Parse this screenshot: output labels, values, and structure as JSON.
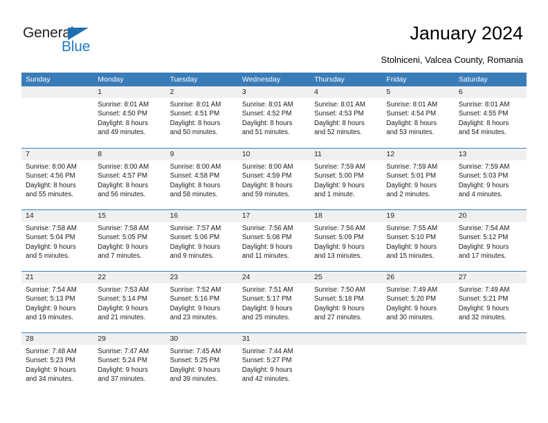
{
  "brand": {
    "name_part1": "General",
    "name_part2": "Blue",
    "triangle_color": "#1f6fb5",
    "blue_color": "#1f7ac4"
  },
  "header": {
    "title": "January 2024",
    "subtitle": "Stolniceni, Valcea County, Romania"
  },
  "colors": {
    "header_band": "#3a7cb8",
    "day_band": "#f0f0f0",
    "text": "#000000"
  },
  "weekdays": [
    "Sunday",
    "Monday",
    "Tuesday",
    "Wednesday",
    "Thursday",
    "Friday",
    "Saturday"
  ],
  "weeks": [
    [
      {
        "day": "",
        "sunrise": "",
        "sunset": "",
        "daylight_line1": "",
        "daylight_line2": "",
        "empty": true
      },
      {
        "day": "1",
        "sunrise": "Sunrise: 8:01 AM",
        "sunset": "Sunset: 4:50 PM",
        "daylight_line1": "Daylight: 8 hours",
        "daylight_line2": "and 49 minutes."
      },
      {
        "day": "2",
        "sunrise": "Sunrise: 8:01 AM",
        "sunset": "Sunset: 4:51 PM",
        "daylight_line1": "Daylight: 8 hours",
        "daylight_line2": "and 50 minutes."
      },
      {
        "day": "3",
        "sunrise": "Sunrise: 8:01 AM",
        "sunset": "Sunset: 4:52 PM",
        "daylight_line1": "Daylight: 8 hours",
        "daylight_line2": "and 51 minutes."
      },
      {
        "day": "4",
        "sunrise": "Sunrise: 8:01 AM",
        "sunset": "Sunset: 4:53 PM",
        "daylight_line1": "Daylight: 8 hours",
        "daylight_line2": "and 52 minutes."
      },
      {
        "day": "5",
        "sunrise": "Sunrise: 8:01 AM",
        "sunset": "Sunset: 4:54 PM",
        "daylight_line1": "Daylight: 8 hours",
        "daylight_line2": "and 53 minutes."
      },
      {
        "day": "6",
        "sunrise": "Sunrise: 8:01 AM",
        "sunset": "Sunset: 4:55 PM",
        "daylight_line1": "Daylight: 8 hours",
        "daylight_line2": "and 54 minutes."
      }
    ],
    [
      {
        "day": "7",
        "sunrise": "Sunrise: 8:00 AM",
        "sunset": "Sunset: 4:56 PM",
        "daylight_line1": "Daylight: 8 hours",
        "daylight_line2": "and 55 minutes."
      },
      {
        "day": "8",
        "sunrise": "Sunrise: 8:00 AM",
        "sunset": "Sunset: 4:57 PM",
        "daylight_line1": "Daylight: 8 hours",
        "daylight_line2": "and 56 minutes."
      },
      {
        "day": "9",
        "sunrise": "Sunrise: 8:00 AM",
        "sunset": "Sunset: 4:58 PM",
        "daylight_line1": "Daylight: 8 hours",
        "daylight_line2": "and 58 minutes."
      },
      {
        "day": "10",
        "sunrise": "Sunrise: 8:00 AM",
        "sunset": "Sunset: 4:59 PM",
        "daylight_line1": "Daylight: 8 hours",
        "daylight_line2": "and 59 minutes."
      },
      {
        "day": "11",
        "sunrise": "Sunrise: 7:59 AM",
        "sunset": "Sunset: 5:00 PM",
        "daylight_line1": "Daylight: 9 hours",
        "daylight_line2": "and 1 minute."
      },
      {
        "day": "12",
        "sunrise": "Sunrise: 7:59 AM",
        "sunset": "Sunset: 5:01 PM",
        "daylight_line1": "Daylight: 9 hours",
        "daylight_line2": "and 2 minutes."
      },
      {
        "day": "13",
        "sunrise": "Sunrise: 7:59 AM",
        "sunset": "Sunset: 5:03 PM",
        "daylight_line1": "Daylight: 9 hours",
        "daylight_line2": "and 4 minutes."
      }
    ],
    [
      {
        "day": "14",
        "sunrise": "Sunrise: 7:58 AM",
        "sunset": "Sunset: 5:04 PM",
        "daylight_line1": "Daylight: 9 hours",
        "daylight_line2": "and 5 minutes."
      },
      {
        "day": "15",
        "sunrise": "Sunrise: 7:58 AM",
        "sunset": "Sunset: 5:05 PM",
        "daylight_line1": "Daylight: 9 hours",
        "daylight_line2": "and 7 minutes."
      },
      {
        "day": "16",
        "sunrise": "Sunrise: 7:57 AM",
        "sunset": "Sunset: 5:06 PM",
        "daylight_line1": "Daylight: 9 hours",
        "daylight_line2": "and 9 minutes."
      },
      {
        "day": "17",
        "sunrise": "Sunrise: 7:56 AM",
        "sunset": "Sunset: 5:08 PM",
        "daylight_line1": "Daylight: 9 hours",
        "daylight_line2": "and 11 minutes."
      },
      {
        "day": "18",
        "sunrise": "Sunrise: 7:56 AM",
        "sunset": "Sunset: 5:09 PM",
        "daylight_line1": "Daylight: 9 hours",
        "daylight_line2": "and 13 minutes."
      },
      {
        "day": "19",
        "sunrise": "Sunrise: 7:55 AM",
        "sunset": "Sunset: 5:10 PM",
        "daylight_line1": "Daylight: 9 hours",
        "daylight_line2": "and 15 minutes."
      },
      {
        "day": "20",
        "sunrise": "Sunrise: 7:54 AM",
        "sunset": "Sunset: 5:12 PM",
        "daylight_line1": "Daylight: 9 hours",
        "daylight_line2": "and 17 minutes."
      }
    ],
    [
      {
        "day": "21",
        "sunrise": "Sunrise: 7:54 AM",
        "sunset": "Sunset: 5:13 PM",
        "daylight_line1": "Daylight: 9 hours",
        "daylight_line2": "and 19 minutes."
      },
      {
        "day": "22",
        "sunrise": "Sunrise: 7:53 AM",
        "sunset": "Sunset: 5:14 PM",
        "daylight_line1": "Daylight: 9 hours",
        "daylight_line2": "and 21 minutes."
      },
      {
        "day": "23",
        "sunrise": "Sunrise: 7:52 AM",
        "sunset": "Sunset: 5:16 PM",
        "daylight_line1": "Daylight: 9 hours",
        "daylight_line2": "and 23 minutes."
      },
      {
        "day": "24",
        "sunrise": "Sunrise: 7:51 AM",
        "sunset": "Sunset: 5:17 PM",
        "daylight_line1": "Daylight: 9 hours",
        "daylight_line2": "and 25 minutes."
      },
      {
        "day": "25",
        "sunrise": "Sunrise: 7:50 AM",
        "sunset": "Sunset: 5:18 PM",
        "daylight_line1": "Daylight: 9 hours",
        "daylight_line2": "and 27 minutes."
      },
      {
        "day": "26",
        "sunrise": "Sunrise: 7:49 AM",
        "sunset": "Sunset: 5:20 PM",
        "daylight_line1": "Daylight: 9 hours",
        "daylight_line2": "and 30 minutes."
      },
      {
        "day": "27",
        "sunrise": "Sunrise: 7:49 AM",
        "sunset": "Sunset: 5:21 PM",
        "daylight_line1": "Daylight: 9 hours",
        "daylight_line2": "and 32 minutes."
      }
    ],
    [
      {
        "day": "28",
        "sunrise": "Sunrise: 7:48 AM",
        "sunset": "Sunset: 5:23 PM",
        "daylight_line1": "Daylight: 9 hours",
        "daylight_line2": "and 34 minutes."
      },
      {
        "day": "29",
        "sunrise": "Sunrise: 7:47 AM",
        "sunset": "Sunset: 5:24 PM",
        "daylight_line1": "Daylight: 9 hours",
        "daylight_line2": "and 37 minutes."
      },
      {
        "day": "30",
        "sunrise": "Sunrise: 7:45 AM",
        "sunset": "Sunset: 5:25 PM",
        "daylight_line1": "Daylight: 9 hours",
        "daylight_line2": "and 39 minutes."
      },
      {
        "day": "31",
        "sunrise": "Sunrise: 7:44 AM",
        "sunset": "Sunset: 5:27 PM",
        "daylight_line1": "Daylight: 9 hours",
        "daylight_line2": "and 42 minutes."
      },
      {
        "day": "",
        "sunrise": "",
        "sunset": "",
        "daylight_line1": "",
        "daylight_line2": "",
        "empty": true
      },
      {
        "day": "",
        "sunrise": "",
        "sunset": "",
        "daylight_line1": "",
        "daylight_line2": "",
        "empty": true
      },
      {
        "day": "",
        "sunrise": "",
        "sunset": "",
        "daylight_line1": "",
        "daylight_line2": "",
        "empty": true
      }
    ]
  ]
}
